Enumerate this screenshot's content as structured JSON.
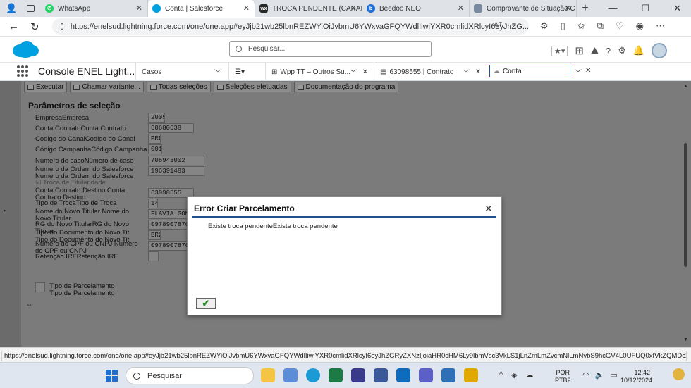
{
  "browser": {
    "tabs": [
      {
        "label": "WhatsApp",
        "favicon_color": "#25D366"
      },
      {
        "label": "Conta | Salesforce",
        "favicon_color": "#00A1E0"
      },
      {
        "label": "TROCA PENDENTE (CANAL V",
        "favicon_color": "#2b2b2b"
      },
      {
        "label": "Beedoo NEO",
        "favicon_color": "#1e6fd9"
      },
      {
        "label": "Comprovante de Situação C",
        "favicon_color": "#7a8aa0"
      }
    ],
    "active_tab_index": 1,
    "url": "https://enelsud.lightning.force.com/one/one.app#eyJjb21wb25lbnREZWYiOiJvbmU6YWxvaGFQYWdlIiwiYXR0cmlidXRlcyI6eyJhZG...",
    "read_aloud_label": "Aᵀ"
  },
  "salesforce": {
    "search_placeholder": "Pesquisar...",
    "app_name": "Console ENEL Light...",
    "nav_item": "Casos",
    "workspace_tabs": [
      {
        "label": "Wpp TT – Outros Su..."
      },
      {
        "label": "63098555 | Contrato"
      },
      {
        "label": "Conta"
      }
    ]
  },
  "sap": {
    "toolbar": [
      {
        "label": "Executar"
      },
      {
        "label": "Chamar variante..."
      },
      {
        "label": "Todas seleções"
      },
      {
        "label": "Seleções efetuadas"
      },
      {
        "label": "Documentação do programa"
      }
    ],
    "section_title": "Parâmetros de seleção",
    "rows": [
      {
        "label": "EmpresaEmpresa",
        "value": "2005"
      },
      {
        "label": "Conta ContratoConta Contrato",
        "value": "60680638"
      },
      {
        "label": "Codigo do CanalCodigo do Canal",
        "value": "PRE"
      },
      {
        "label": "Código CampanhaCódigo Campanha",
        "value": "001"
      },
      {
        "label": "Número de casoNúmero de caso",
        "value": "706943002"
      },
      {
        "label": "Numero da Ordem do Salesforce Numero da Ordem do Salesforce",
        "value": "196391483"
      },
      {
        "label": "Conta Contrato Destino Conta Contrato Destino",
        "value": "63098555"
      },
      {
        "label": "Tipo de TrocaTipo de Troca",
        "value": "14"
      },
      {
        "label": "Nome do Novo Titular Nome do Novo Titular",
        "value": "FLAVIA GOMES"
      },
      {
        "label": "RG do Novo TitularRG do Novo Titular",
        "value": "0978907876"
      },
      {
        "label": "Tipo do Documento do Novo Tit Tipo do Documento do Novo Tit",
        "value": "BR2"
      },
      {
        "label": "Numero do CPF ou CNPJ Numero do CPF ou CNPJ",
        "value": "0978907876"
      },
      {
        "label": "Retenção IRFRetenção IRF",
        "value": ""
      }
    ],
    "checkbox_label": "Troca de Titularidade",
    "bottom_label": "Tipo de Parcelamento Tipo de Parcelamento",
    "dash": "--"
  },
  "dialog": {
    "title": "Error Criar Parcelamento",
    "message": "Existe troca pendenteExiste troca pendente",
    "close_glyph": "✕",
    "ok_glyph": "✔"
  },
  "status_url": "https://enelsud.lightning.force.com/one/one.app#eyJjb21wb25lbnREZWYiOiJvbmU6YWxvaGFQYWdlIiwiYXR0cmlidXRlcyI6eyJhZGRyZXNzIjoiaHR0cHM6Ly9lbmVsc3VkLS1jLnZmLmZvcmNlLmNvbS9hcGV4L0UFUQ0xfVkZQMDc2X0FncmVmVlbWVudFJlcXVl...",
  "taskbar": {
    "search_label": "Pesquisar",
    "lang_top": "POR",
    "lang_bottom": "PTB2",
    "time": "12:42",
    "date": "10/12/2024"
  }
}
